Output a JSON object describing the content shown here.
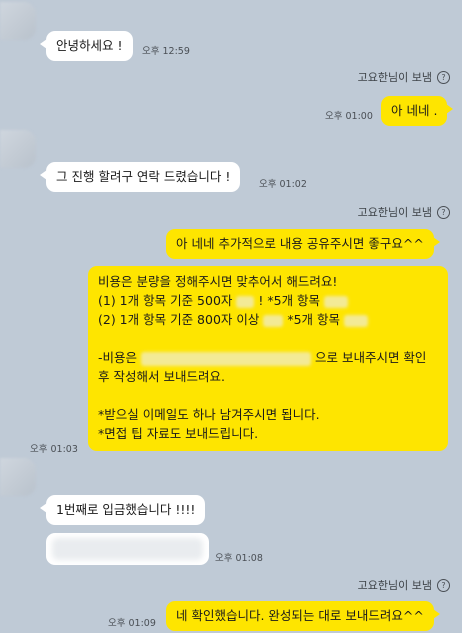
{
  "messages": [
    {
      "text": "안녕하세요 !",
      "time": "오후 12:59"
    },
    {
      "sender": "고요한님이 보냄",
      "text": "아 네네 .",
      "time": "오후 01:00"
    },
    {
      "text": "그 진행 할려구 연락 드렸습니다 !",
      "time": "오후 01:02"
    },
    {
      "sender": "고요한님이 보냄",
      "text": "아 네네 추가적으로 내용 공유주시면 좋구요^^"
    },
    {
      "lines": [
        "비용은 분량을 정해주시면 맞추어서 해드려요!",
        "(1) 1개 항목 기준 500자",
        "! *5개 항목",
        "(2) 1개 항목 기준 800자 이상",
        "*5개 항목",
        "-비용은",
        "으로 보내주시면 확인",
        "후 작성해서 보내드려요.",
        "*받으실 이메일도 하나 남겨주시면 됩니다.",
        "*면접 팁 자료도 보내드립니다."
      ],
      "time": "오후 01:03"
    },
    {
      "text": "1번째로 입금했습니다 !!!!"
    },
    {
      "time": "오후 01:08"
    },
    {
      "sender": "고요한님이 보냄",
      "text": "네 확인했습니다. 완성되는 대로 보내드려요^^",
      "time": "오후 01:09"
    }
  ],
  "icons": {
    "help": "question-circle-icon"
  }
}
